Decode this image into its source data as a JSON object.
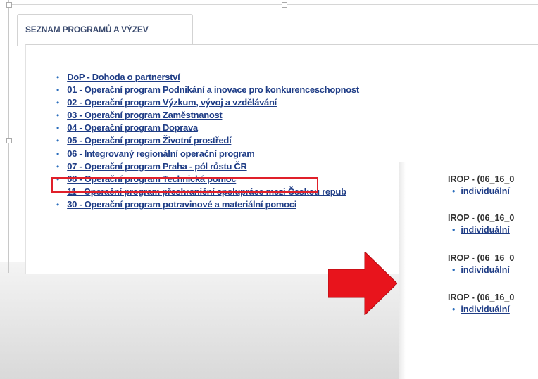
{
  "tab": {
    "label": "SEZNAM PROGRAMŮ A VÝZEV"
  },
  "programs": [
    "DoP - Dohoda o partnerství",
    "01 - Operační program Podnikání a inovace pro konkurenceschopnost",
    "02 - Operační program Výzkum, vývoj a vzdělávání",
    "03 - Operační program Zaměstnanost",
    "04 - Operační program Doprava",
    "05 - Operační program Životní prostředí",
    "06 - Integrovaný regionální operační program",
    "07 - Operační program Praha - pól růstu ČR",
    "08 - Operační program Technická pomoc",
    "11 - Operační program přeshraniční spolupráce mezi Českou repub",
    "30 - Operační program potravinové a materiální pomoci"
  ],
  "highlighted_index": 6,
  "highlight_color": "#e0202a",
  "arrow_color": "#e8141c",
  "link_color": "#1f3d86",
  "overlay": {
    "groups": [
      {
        "title": "IROP - (06_16_0",
        "link": "individuální"
      },
      {
        "title": "IROP - (06_16_0",
        "link": "individuální"
      },
      {
        "title": "IROP - (06_16_0",
        "link": "individuální"
      },
      {
        "title": "IROP - (06_16_0",
        "link": "individuální"
      }
    ]
  },
  "icons": {
    "bullet": "bullet-icon",
    "arrow": "right-arrow-icon"
  }
}
